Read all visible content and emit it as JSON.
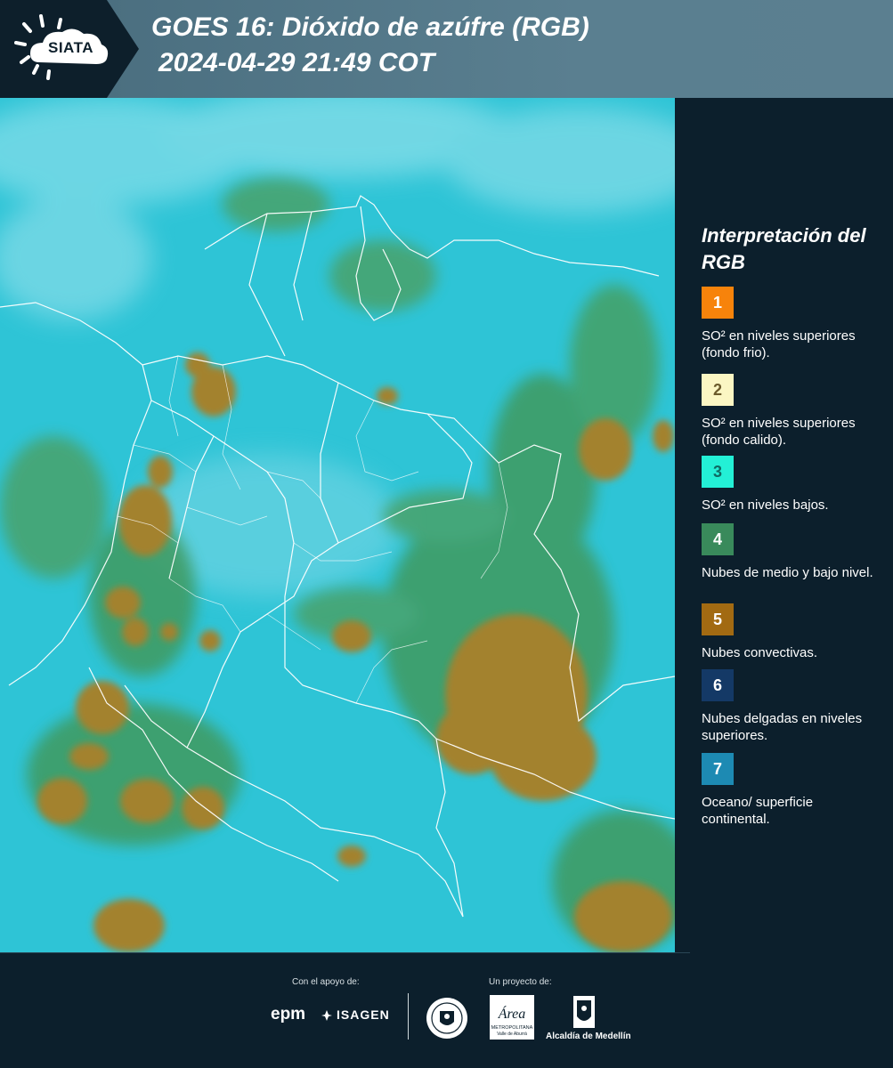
{
  "header": {
    "logo_text": "SIATA",
    "title_line1": "GOES 16: Dióxido de azúfre (RGB)",
    "title_line2": "2024-04-29 21:49 COT"
  },
  "legend": {
    "title": "Interpretación del RGB",
    "items": [
      {
        "number": "1",
        "label": "SO² en niveles superiores (fondo frio).",
        "color": "#f7830b"
      },
      {
        "number": "2",
        "label": "SO² en niveles superiores (fondo calido).",
        "color": "#fbf6c3"
      },
      {
        "number": "3",
        "label": "SO² en niveles bajos.",
        "color": "#23f0d6"
      },
      {
        "number": "4",
        "label": "Nubes de medio y bajo nivel.",
        "color": "#398a5b"
      },
      {
        "number": "5",
        "label": "Nubes convectivas.",
        "color": "#a26a12"
      },
      {
        "number": "6",
        "label": "Nubes delgadas en niveles superiores.",
        "color": "#143966"
      },
      {
        "number": "7",
        "label": "Oceano/ superficie continental.",
        "color": "#1d8ab3"
      }
    ]
  },
  "footer": {
    "support_label": "Con el apoyo de:",
    "project_label": "Un proyecto de:",
    "sponsor_1": "epm",
    "sponsor_2": "ISAGEN",
    "partner_area": "Área",
    "partner_area_sub": "METROPOLITANA",
    "partner_area_sub2": "Valle de Aburrá",
    "partner_alcaldia": "Alcaldía de Medellín"
  },
  "map": {
    "colors": {
      "background": "#2cc3d4",
      "convective": "#a3822d",
      "midlevel": "#3f9a5e",
      "borders": "#ffffff"
    }
  }
}
